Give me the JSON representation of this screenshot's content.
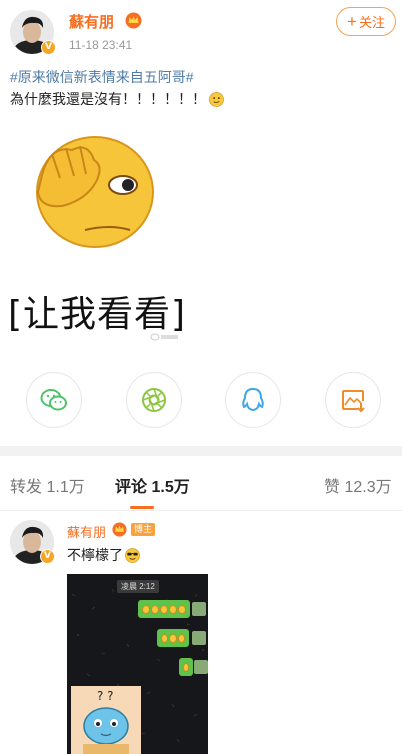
{
  "post": {
    "author": "蘇有朋",
    "time": "11-18 23:41",
    "follow_label": "关注",
    "hashtag": "#原来微信新表情来自五阿哥#",
    "text": "為什麼我還是沒有！！！！！！",
    "sticker_caption": "[让我看看]"
  },
  "share": {
    "icons": [
      "wechat-icon",
      "moments-icon",
      "qq-icon",
      "save-image-icon"
    ]
  },
  "tabs": {
    "repost": {
      "label": "转发",
      "count": "1.1万"
    },
    "comment": {
      "label": "评论",
      "count": "1.5万"
    },
    "like": {
      "label": "赞",
      "count": "12.3万"
    }
  },
  "comment": {
    "author": "蘇有朋",
    "badge": "博主",
    "text": "不檸檬了",
    "screenshot_time": "凌晨 2:12"
  },
  "colors": {
    "accent": "#f86e21",
    "link": "#4e7ba7",
    "bubble": "#5ec24b"
  }
}
